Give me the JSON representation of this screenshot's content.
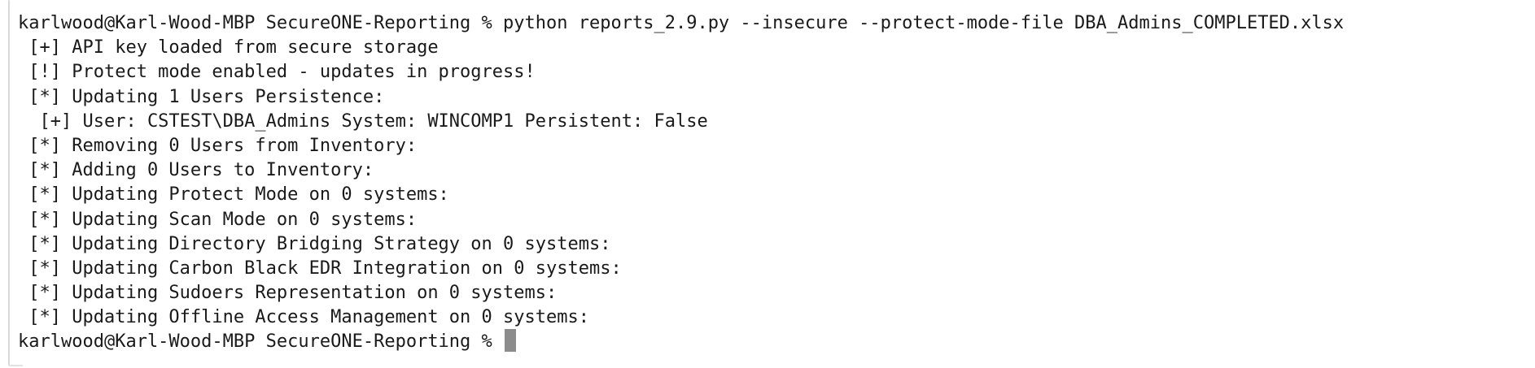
{
  "terminal": {
    "command_prompt": "karlwood@Karl-Wood-MBP SecureONE-Reporting % ",
    "command": "python reports_2.9.py --insecure --protect-mode-file DBA_Admins_COMPLETED.xlsx",
    "output": [
      " [+] API key loaded from secure storage",
      " [!] Protect mode enabled - updates in progress!",
      " [*] Updating 1 Users Persistence:",
      "  [+] User: CSTEST\\DBA_Admins System: WINCOMP1 Persistent: False",
      " [*] Removing 0 Users from Inventory:",
      " [*] Adding 0 Users to Inventory:",
      " [*] Updating Protect Mode on 0 systems:",
      " [*] Updating Scan Mode on 0 systems:",
      " [*] Updating Directory Bridging Strategy on 0 systems:",
      " [*] Updating Carbon Black EDR Integration on 0 systems:",
      " [*] Updating Sudoers Representation on 0 systems:",
      " [*] Updating Offline Access Management on 0 systems:"
    ],
    "final_prompt": "karlwood@Karl-Wood-MBP SecureONE-Reporting % "
  }
}
